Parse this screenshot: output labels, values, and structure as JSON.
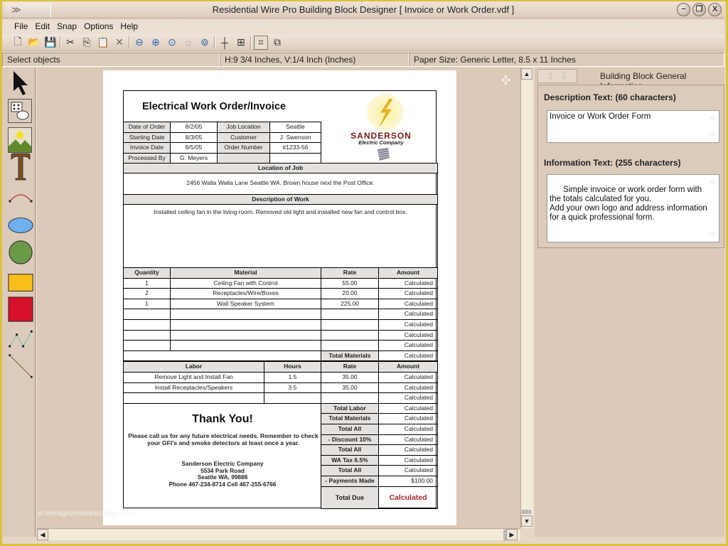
{
  "window": {
    "title": "Residential Wire Pro Building Block Designer [ Invoice or Work Order.vdf ]",
    "buttons": {
      "minimize": "−",
      "restore": "❐",
      "close": "X"
    }
  },
  "menu": [
    "File",
    "Edit",
    "Snap",
    "Options",
    "Help"
  ],
  "toolbar": [
    {
      "name": "new-icon",
      "glyph": "🗋"
    },
    {
      "name": "open-icon",
      "glyph": "📂"
    },
    {
      "name": "save-icon",
      "glyph": "💾"
    },
    {
      "name": "cut-icon",
      "glyph": "✂"
    },
    {
      "name": "copy-icon",
      "glyph": "⎘"
    },
    {
      "name": "paste-icon",
      "glyph": "📋"
    },
    {
      "name": "delete-icon",
      "glyph": "✕"
    },
    {
      "name": "zoom-out-icon",
      "glyph": "⊖"
    },
    {
      "name": "zoom-in-icon",
      "glyph": "⊕"
    },
    {
      "name": "zoom-page-icon",
      "glyph": "⊙"
    },
    {
      "name": "zoom-fit-icon",
      "glyph": "◌"
    },
    {
      "name": "zoom-selection-icon",
      "glyph": "⊚"
    },
    {
      "name": "snap-grid-icon",
      "glyph": "┼"
    },
    {
      "name": "snap-box-icon",
      "glyph": "⊞"
    },
    {
      "name": "select-box-icon",
      "glyph": "⌗"
    },
    {
      "name": "resize-box-icon",
      "glyph": "⧉"
    }
  ],
  "status": {
    "mode": "Select objects",
    "position": "H:9 3/4 Inches, V:1/4 Inch (Inches)",
    "paper": "Paper Size: Generic Letter, 8.5 x 11 Inches"
  },
  "tools": [
    "select-arrow-icon",
    "building-block-icon",
    "picture-icon",
    "text-icon",
    "arc-icon",
    "ellipse-icon",
    "circle-icon",
    "rectangle-icon",
    "filled-square-icon",
    "polyline-icon",
    "line-icon"
  ],
  "colors": {
    "ellipse": "#6fb0ef",
    "circle": "#6a9a48",
    "rectangle": "#f7bf18",
    "square": "#d7112b",
    "total_due": "#a8272a",
    "logo_text": "#7b1919"
  },
  "invoice": {
    "title": "Electrical Work Order/Invoice",
    "logo": {
      "name": "SANDERSON",
      "sub": "Electric Company"
    },
    "info": [
      [
        "Date of Order",
        "8/2/05",
        "Job Location",
        "Seattle"
      ],
      [
        "Starting Date",
        "8/3/05",
        "Customer",
        "J. Swenson"
      ],
      [
        "Invoice Date",
        "8/5/05",
        "Order Number",
        "#1233-56"
      ],
      [
        "Processed By",
        "G. Meyers",
        "",
        ""
      ]
    ],
    "location_header": "Location of Job",
    "location": "2456 Walla Walla Lane Seattle WA. Brown house next the Post Office.",
    "description_header": "Description of Work",
    "description": "Installed ceiling fan in the living room. Removed old light and installed new fan and control box.",
    "materials_headers": [
      "Quantity",
      "Material",
      "Rate",
      "Amount"
    ],
    "materials": [
      [
        "1",
        "Ceiling Fan with Control",
        "55.00",
        "Calculated"
      ],
      [
        "2",
        "Receptacles/Wire/Boxes",
        "20.00",
        "Calculated"
      ],
      [
        "1",
        "Wall Speaker System",
        "225.00",
        "Calculated"
      ],
      [
        "",
        "",
        "",
        "Calculated"
      ],
      [
        "",
        "",
        "",
        "Calculated"
      ],
      [
        "",
        "",
        "",
        "Calculated"
      ],
      [
        "",
        "",
        "",
        "Calculated"
      ]
    ],
    "total_materials": [
      "Total Materials",
      "Calculated"
    ],
    "labor_headers": [
      "Labor",
      "Hours",
      "Rate",
      "Amount"
    ],
    "labor": [
      [
        "Remove Light and Install Fan",
        "1.5",
        "35.00",
        "Calculated"
      ],
      [
        "Install Receptacles/Speakers",
        "3.5",
        "35.00",
        "Calculated"
      ],
      [
        "",
        "",
        "",
        "Calculated"
      ]
    ],
    "totals": [
      [
        "Total Labor",
        "Calculated"
      ],
      [
        "Total Materials",
        "Calculated"
      ],
      [
        "Total All",
        "Calculated"
      ],
      [
        "- Discount 10%",
        "Calculated"
      ],
      [
        "Total All",
        "Calculated"
      ],
      [
        "WA Tax 6.5%",
        "Calculated"
      ],
      [
        "Total All",
        "Calculated"
      ],
      [
        "- Payments Made",
        "$100.00"
      ]
    ],
    "total_due": [
      "Total Due",
      "Calculated"
    ],
    "thanks": "Thank You!",
    "note": "Please call us for any future electrical needs. Remember to check your GFI's and smoke detectors at least once a year.",
    "company": [
      "Sanderson Electric Company",
      "5534 Park Road",
      "Seattle WA, 99888",
      "Phone 467-234-8714  Cell 467-255-6766"
    ]
  },
  "panel": {
    "tab_title": "Building Block General Information",
    "desc_label": "Description Text: (60 characters)",
    "desc_value": "Invoice or Work Order Form",
    "info_label": "Information Text: (255 characters)",
    "info_value": "Simple invoice or work order form with the totals calculated for you.\nAdd your own logo and address information for a quick professional form."
  },
  "watermark": "www.heritagechristiancollege.com"
}
